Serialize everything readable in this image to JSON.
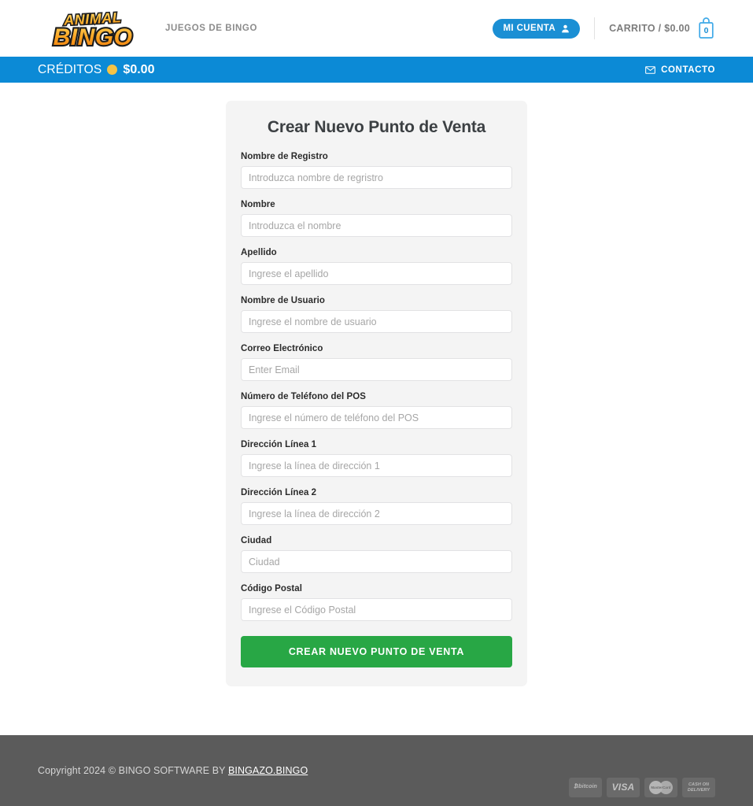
{
  "header": {
    "logo_line1": "ANIMAL",
    "logo_line2": "BINGO",
    "tagline": "JUEGOS DE BINGO",
    "account_button": "MI CUENTA",
    "cart_label": "CARRITO / $0.00",
    "cart_count": "0"
  },
  "credits_bar": {
    "label": "CRÉDITOS",
    "amount": "$0.00",
    "contact_label": "CONTACTO",
    "background_color": "#0c8ad6",
    "coin_color": "#f5c345"
  },
  "form": {
    "title": "Crear Nuevo Punto de Venta",
    "submit_label": "CREAR NUEVO PUNTO DE VENTA",
    "submit_color": "#28a745",
    "fields": [
      {
        "label": "Nombre de Registro",
        "placeholder": "Introduzca nombre de regristro",
        "value": ""
      },
      {
        "label": "Nombre",
        "placeholder": "Introduzca el nombre",
        "value": ""
      },
      {
        "label": "Apellido",
        "placeholder": "Ingrese el apellido",
        "value": ""
      },
      {
        "label": "Nombre de Usuario",
        "placeholder": "Ingrese el nombre de usuario",
        "value": ""
      },
      {
        "label": "Correo Electrónico",
        "placeholder": "Enter Email",
        "value": ""
      },
      {
        "label": "Número de Teléfono del POS",
        "placeholder": "Ingrese el número de teléfono del POS",
        "value": ""
      },
      {
        "label": "Dirección Línea 1",
        "placeholder": "Ingrese la línea de dirección 1",
        "value": ""
      },
      {
        "label": "Dirección Línea 2",
        "placeholder": "Ingrese la línea de dirección 2",
        "value": ""
      },
      {
        "label": "Ciudad",
        "placeholder": "Ciudad",
        "value": ""
      },
      {
        "label": "Código Postal",
        "placeholder": "Ingrese el Código Postal",
        "value": ""
      }
    ]
  },
  "footer": {
    "copyright_prefix": "Copyright 2024 © BINGO SOFTWARE BY ",
    "brand_link": "BINGAZO.BINGO",
    "background_color": "#5b5b5b",
    "payment_methods": [
      {
        "name": "bitcoin",
        "text": "₿bitcoin"
      },
      {
        "name": "visa",
        "text": "VISA"
      },
      {
        "name": "mastercard",
        "text": "MasterCard"
      },
      {
        "name": "cash-on-delivery",
        "text": "CASH ON DELIVERY"
      }
    ]
  }
}
